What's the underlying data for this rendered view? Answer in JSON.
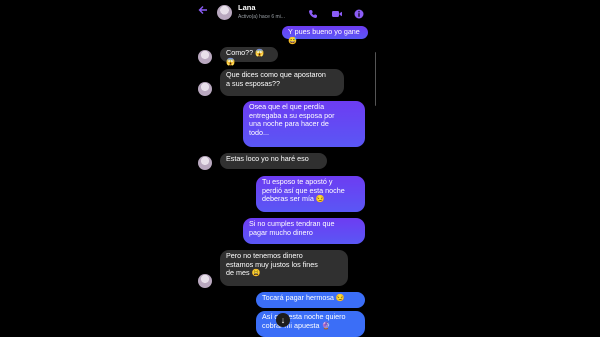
{
  "header": {
    "back_icon": "arrow-left-icon",
    "contact_name": "Lana",
    "status": "Activo(a) hace 6 mi...",
    "icons": [
      "phone-icon",
      "video-icon",
      "info-icon"
    ],
    "accent_color": "#8b5cf6"
  },
  "messages": [
    {
      "side": "sent",
      "text": "Y pues bueno yo gane 😅"
    },
    {
      "side": "received",
      "text": "Como?? 😱😱"
    },
    {
      "side": "received",
      "text": "Que dices como que apostaron\na sus esposas??"
    },
    {
      "side": "sent",
      "text": "Osea que el que perdía\nentregaba a su esposa por\nuna noche para hacer de\ntodo..."
    },
    {
      "side": "received",
      "text": "Estas loco yo no haré eso"
    },
    {
      "side": "sent",
      "text": "Tu esposo te apostó y\nperdió así que esta noche\ndeberas ser mía 😏"
    },
    {
      "side": "sent",
      "text": "Si no cumples tendran que\npagar mucho dinero"
    },
    {
      "side": "received",
      "text": "Pero no tenemos dinero\nestamos muy justos los fines\nde mes 😩"
    },
    {
      "side": "sent",
      "text": "Tocará pagar hermosa 😏"
    },
    {
      "side": "sent",
      "text": "Así que esta noche quiero\ncobrar mi apuesta 🔮"
    }
  ],
  "scroll_button_icon": "arrow-down-icon"
}
